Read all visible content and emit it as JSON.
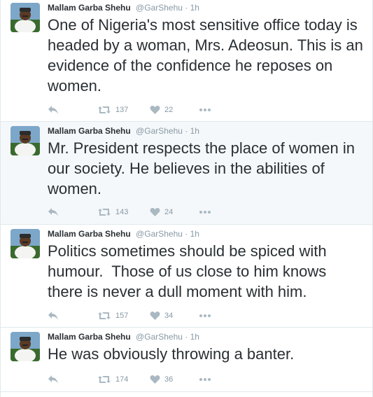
{
  "user": {
    "name": "Mallam Garba Shehu",
    "handle": "@GarShehu",
    "separator": " · ",
    "time": "1h"
  },
  "tweets": [
    {
      "text": "One of Nigeria's most sensitive office today is headed by a woman, Mrs. Adeosun. This is an evidence of the confidence he reposes on women.",
      "retweets": "137",
      "likes": "22"
    },
    {
      "text": "Mr. President respects the place of women in our society. He believes in the abilities of women.",
      "retweets": "143",
      "likes": "24"
    },
    {
      "text": "Politics sometimes should be spiced with humour.  Those of us close to him knows there is never a dull moment with him.",
      "retweets": "157",
      "likes": "34"
    },
    {
      "text": "He was obviously throwing a banter.",
      "retweets": "174",
      "likes": "36"
    }
  ],
  "icons": {
    "reply": "reply-icon",
    "retweet": "retweet-icon",
    "like": "heart-icon",
    "more": "more-icon"
  },
  "colors": {
    "text": "#292f33",
    "muted": "#8899a6",
    "icon": "#aab8c2",
    "alt_background": "#f5f8fa",
    "border": "#e1e8ed"
  }
}
